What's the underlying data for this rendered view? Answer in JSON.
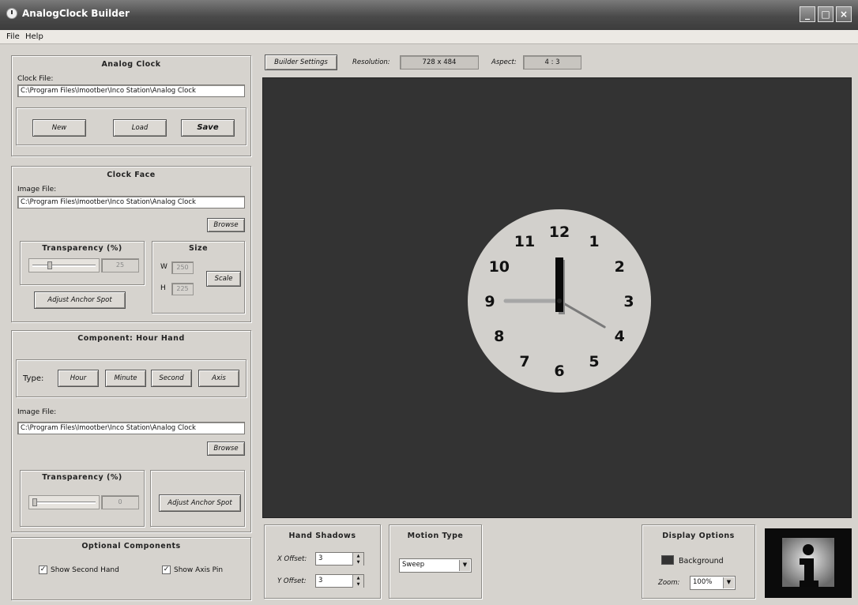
{
  "window": {
    "title": "AnalogClock Builder"
  },
  "menu": {
    "file": "File",
    "help": "Help"
  },
  "analog_clock": {
    "title": "Analog Clock",
    "clock_file_label": "Clock File:",
    "clock_file_value": "C:\\Program Files\\Imootber\\Inco Station\\Analog Clock",
    "new_label": "New",
    "load_label": "Load",
    "save_label": "Save"
  },
  "clock_face": {
    "title": "Clock Face",
    "image_file_label": "Image File:",
    "image_file_value": "C:\\Program Files\\Imootber\\Inco Station\\Analog Clock",
    "browse_label": "Browse",
    "transparency_title": "Transparency (%)",
    "transparency_value": "25",
    "transparency_fraction": 0.25,
    "size_title": "Size",
    "w_label": "W",
    "w_value": "250",
    "h_label": "H",
    "h_value": "225",
    "scale_label": "Scale",
    "adjust_anchor_label": "Adjust Anchor Spot"
  },
  "component": {
    "title": "Component: Hour Hand",
    "type_label": "Type:",
    "types": [
      "Hour",
      "Minute",
      "Second",
      "Axis"
    ],
    "image_file_label": "Image File:",
    "image_file_value": "C:\\Program Files\\Imootber\\Inco Station\\Analog Clock",
    "browse_label": "Browse",
    "transparency_title": "Transparency (%)",
    "transparency_value": "0",
    "transparency_fraction": 0.0,
    "adjust_anchor_label": "Adjust Anchor Spot"
  },
  "optional": {
    "title": "Optional Components",
    "show_second_hand": "Show Second Hand",
    "show_axis_pin": "Show Axis Pin",
    "show_second_checked": true,
    "show_axis_checked": true,
    "check_glyph": "✓"
  },
  "toolbar": {
    "builder_settings": "Builder Settings",
    "resolution_label": "Resolution:",
    "resolution_value": "728 x 484",
    "aspect_label": "Aspect:",
    "aspect_value": "4 : 3"
  },
  "clock": {
    "numbers": [
      "12",
      "1",
      "2",
      "3",
      "4",
      "5",
      "6",
      "7",
      "8",
      "9",
      "10",
      "11"
    ],
    "hour": 12,
    "minute": 0,
    "second": 20,
    "face_color": "#d2d0cc",
    "background_color": "#333333"
  },
  "hand_shadows": {
    "title": "Hand Shadows",
    "x_label": "X Offset:",
    "x_value": "3",
    "y_label": "Y Offset:",
    "y_value": "3"
  },
  "motion": {
    "title": "Motion Type",
    "value": "Sweep"
  },
  "display": {
    "title": "Display Options",
    "background_label": "Background",
    "zoom_label": "Zoom:",
    "zoom_value": "100%"
  },
  "icons": {
    "info_logo": "info-icon"
  }
}
